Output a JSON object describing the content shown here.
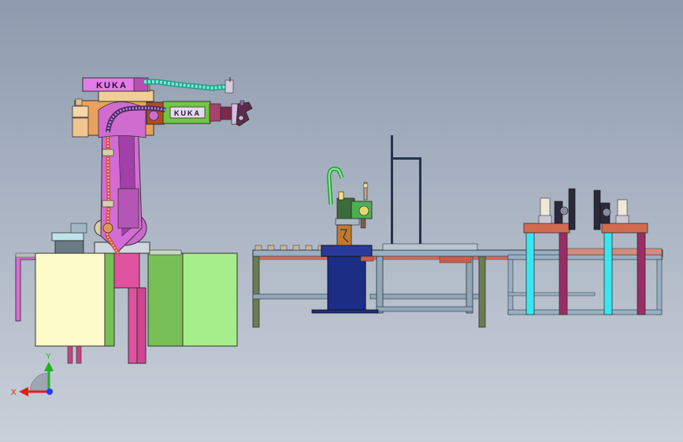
{
  "scene": {
    "robot": {
      "brand_top": "KUKA",
      "brand_arm": "KUKA"
    },
    "axis_triad": {
      "x_label": "X",
      "y_label": "Y",
      "x_color": "#e0201a",
      "y_color": "#1fb31f",
      "z_color": "#1a3cff"
    },
    "colors": {
      "background_top": "#8e9aae",
      "background_bottom": "#c9d0d9",
      "robot_base": "#e0519f",
      "robot_arm": "#d56bd6",
      "cable_teal": "#3fd6b7",
      "cabinet_cream": "#fdfcc8",
      "cabinet_green_dark": "#78bf57",
      "cabinet_green_light": "#a6ee8a",
      "table_blue": "#8fa8bf",
      "pedestal_navy": "#1c2d86",
      "fixture_top": "#d06a50",
      "cyan_leg": "#37e8f2",
      "maroon_leg": "#9a2d66"
    }
  }
}
